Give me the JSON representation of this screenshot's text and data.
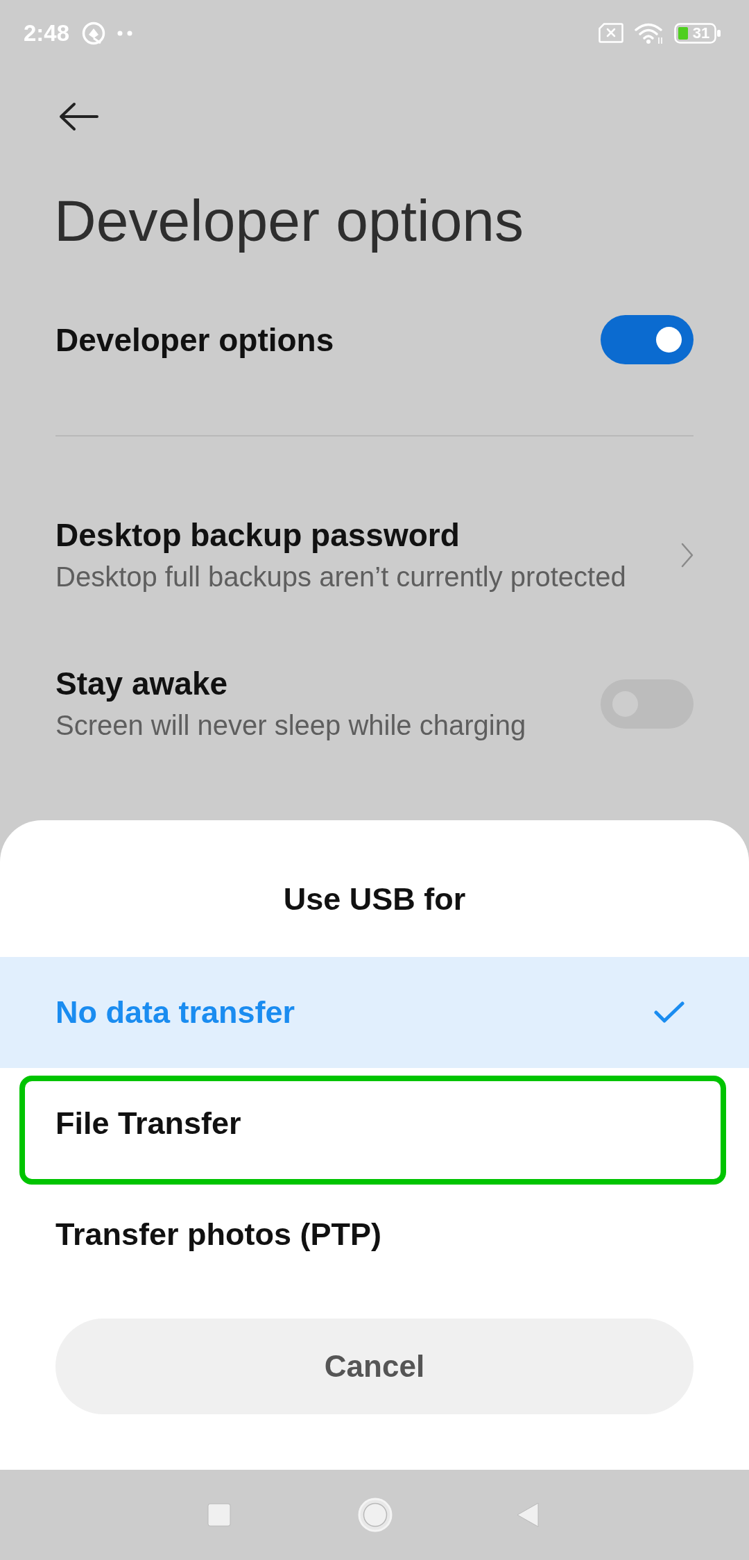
{
  "status_bar": {
    "time": "2:48",
    "battery": "31"
  },
  "header": {
    "title": "Developer options"
  },
  "sections": [
    {
      "items": [
        {
          "kind": "toggle",
          "title": "Developer options",
          "on": true
        }
      ]
    },
    {
      "items": [
        {
          "kind": "link",
          "title": "Desktop backup password",
          "subtitle": "Desktop full backups aren’t currently protected"
        },
        {
          "kind": "toggle",
          "title": "Stay awake",
          "subtitle": "Screen will never sleep while charging",
          "on": false
        }
      ]
    }
  ],
  "sheet": {
    "title": "Use USB for",
    "options": [
      {
        "label": "No data transfer",
        "selected": true,
        "highlighted": false
      },
      {
        "label": "File Transfer",
        "selected": false,
        "highlighted": true
      },
      {
        "label": "Transfer photos (PTP)",
        "selected": false,
        "highlighted": false
      }
    ],
    "cancel": "Cancel"
  }
}
